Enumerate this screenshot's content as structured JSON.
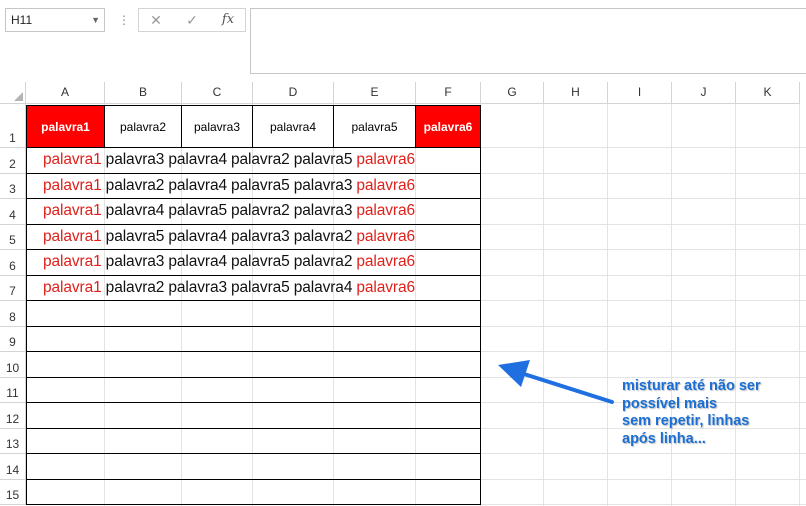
{
  "formula_bar": {
    "name_box": "H11",
    "cancel_icon": "✕",
    "enter_icon": "✓",
    "fx_label": "fx",
    "formula": ""
  },
  "columns": [
    "A",
    "B",
    "C",
    "D",
    "E",
    "F",
    "G",
    "H",
    "I",
    "J",
    "K"
  ],
  "rows": [
    "1",
    "2",
    "3",
    "4",
    "5",
    "6",
    "7",
    "8",
    "9",
    "10",
    "11",
    "12",
    "13",
    "14",
    "15"
  ],
  "header_row": [
    "palavra1",
    "palavra2",
    "palavra3",
    "palavra4",
    "palavra5",
    "palavra6"
  ],
  "data_rows": [
    [
      "palavra1",
      "palavra3",
      "palavra4",
      "palavra2",
      "palavra5",
      "palavra6"
    ],
    [
      "palavra1",
      "palavra2",
      "palavra4",
      "palavra5",
      "palavra3",
      "palavra6"
    ],
    [
      "palavra1",
      "palavra4",
      "palavra5",
      "palavra2",
      "palavra3",
      "palavra6"
    ],
    [
      "palavra1",
      "palavra5",
      "palavra4",
      "palavra3",
      "palavra2",
      "palavra6"
    ],
    [
      "palavra1",
      "palavra3",
      "palavra4",
      "palavra5",
      "palavra2",
      "palavra6"
    ],
    [
      "palavra1",
      "palavra2",
      "palavra3",
      "palavra5",
      "palavra4",
      "palavra6"
    ]
  ],
  "annotation": {
    "lines": [
      "misturar até não ser",
      "possível mais",
      "sem repetir, linhas",
      "após linha..."
    ],
    "color": "#1a6fd6"
  },
  "colors": {
    "highlight_red": "#ff0000",
    "text_red": "#e0201b",
    "arrow_blue": "#1f6fe0"
  }
}
